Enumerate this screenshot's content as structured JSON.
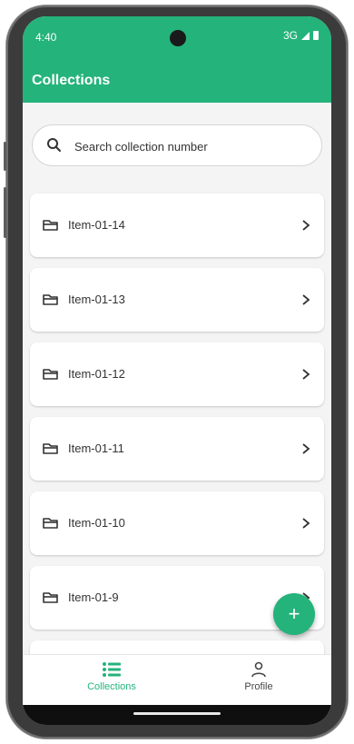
{
  "status_bar": {
    "time": "4:40",
    "network": "3G",
    "icons": [
      "signal-icon",
      "battery-icon"
    ]
  },
  "app_bar": {
    "title": "Collections"
  },
  "search": {
    "placeholder": "Search collection number",
    "value": "",
    "icon": "search-icon"
  },
  "collections": [
    {
      "label": "Item-01-14",
      "icon": "folder-icon"
    },
    {
      "label": "Item-01-13",
      "icon": "folder-icon"
    },
    {
      "label": "Item-01-12",
      "icon": "folder-icon"
    },
    {
      "label": "Item-01-11",
      "icon": "folder-icon"
    },
    {
      "label": "Item-01-10",
      "icon": "folder-icon"
    },
    {
      "label": "Item-01-9",
      "icon": "folder-icon"
    }
  ],
  "fab": {
    "label": "+",
    "icon": "add-icon"
  },
  "bottom_nav": [
    {
      "label": "Collections",
      "icon": "list-icon",
      "active": true
    },
    {
      "label": "Profile",
      "icon": "person-icon",
      "active": false
    }
  ],
  "colors": {
    "primary": "#24b37b",
    "background": "#f4f4f4",
    "text": "#333333"
  }
}
